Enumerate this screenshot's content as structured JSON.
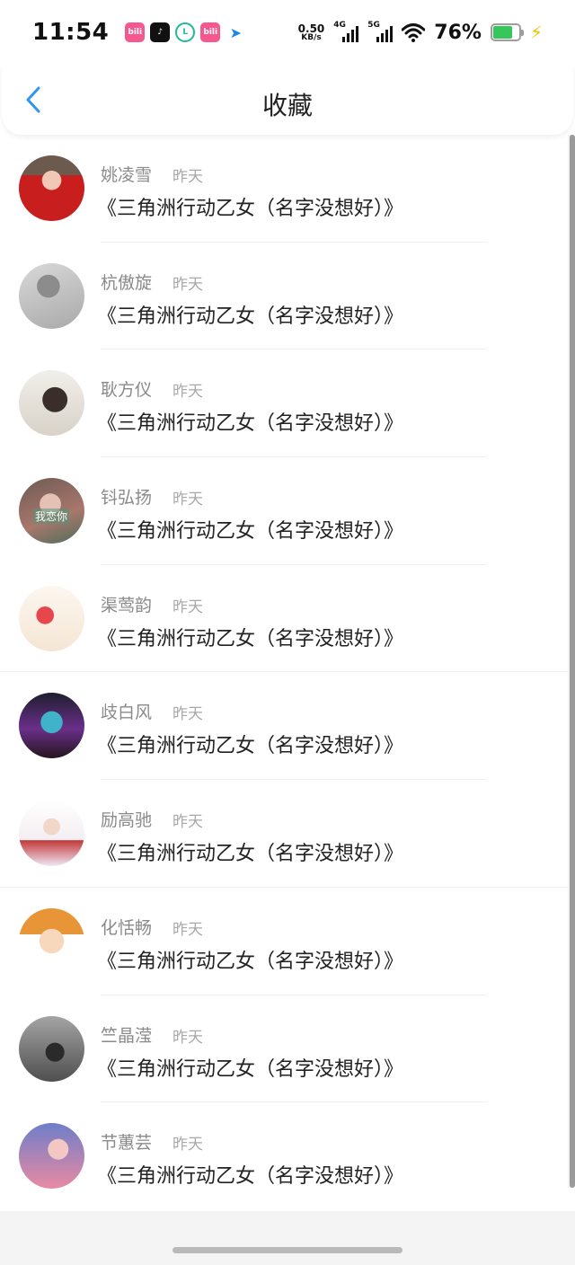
{
  "status_bar": {
    "time": "11:54",
    "notification_icons": [
      {
        "name": "bilibili-icon",
        "text": "bili"
      },
      {
        "name": "tiktok-icon",
        "text": "♪"
      },
      {
        "name": "app-l-icon",
        "text": "L"
      },
      {
        "name": "bilibili-icon-2",
        "text": "bili"
      },
      {
        "name": "send-app-icon",
        "text": "➤"
      }
    ],
    "net_speed_value": "0.50",
    "net_speed_unit": "KB/s",
    "signal_1_label": "4G",
    "signal_2_label": "5G",
    "battery_percent": "76%",
    "battery_level": 0.76,
    "battery_color": "#35c759"
  },
  "nav": {
    "back_icon": "chevron-left-icon",
    "title": "收藏",
    "accent_color": "#2f95f0"
  },
  "favorites": [
    {
      "name": "姚凌雪",
      "time": "昨天",
      "title": "《三角洲行动乙女（名字没想好）》"
    },
    {
      "name": "杭傲旋",
      "time": "昨天",
      "title": "《三角洲行动乙女（名字没想好）》"
    },
    {
      "name": "耿方仪",
      "time": "昨天",
      "title": "《三角洲行动乙女（名字没想好）》"
    },
    {
      "name": "钭弘扬",
      "time": "昨天",
      "title": "《三角洲行动乙女（名字没想好）》"
    },
    {
      "name": "渠莺韵",
      "time": "昨天",
      "title": "《三角洲行动乙女（名字没想好）》"
    },
    {
      "name": "歧白风",
      "time": "昨天",
      "title": "《三角洲行动乙女（名字没想好）》"
    },
    {
      "name": "励高驰",
      "time": "昨天",
      "title": "《三角洲行动乙女（名字没想好）》"
    },
    {
      "name": "化恬畅",
      "time": "昨天",
      "title": "《三角洲行动乙女（名字没想好）》"
    },
    {
      "name": "竺晶滢",
      "time": "昨天",
      "title": "《三角洲行动乙女（名字没想好）》"
    },
    {
      "name": "节蕙芸",
      "time": "昨天",
      "title": "《三角洲行动乙女（名字没想好）》"
    }
  ],
  "avatar_overlay_text": "我恋你"
}
